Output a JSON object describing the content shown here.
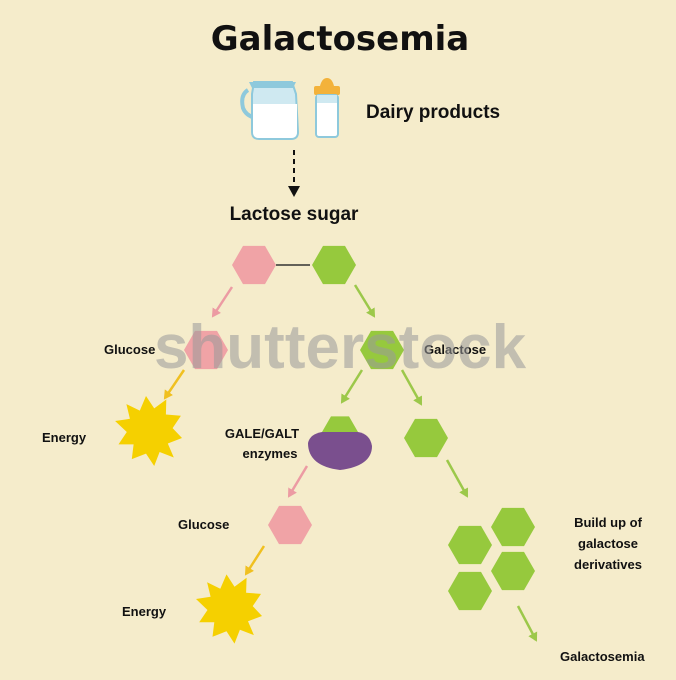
{
  "title": "Galactosemia",
  "dairy_label": "Dairy products",
  "lactose_label": "Lactose sugar",
  "glucose_1": "Glucose",
  "galactose_label": "Galactose",
  "energy_1": "Energy",
  "enzyme_line1": "GALE/GALT",
  "enzyme_line2": "enzymes",
  "glucose_2": "Glucose",
  "energy_2": "Energy",
  "buildup_line1": "Build up of",
  "buildup_line2": "galactose",
  "buildup_line3": "derivatives",
  "result_label": "Galactosemia",
  "watermark": "shutterstock",
  "colors": {
    "background": "#f5eccb",
    "glucose_pink": "#f0a3a6",
    "galactose_green": "#96c93d",
    "enzyme_purple": "#7a4f8e",
    "sun_yellow": "#f5d000",
    "arrow_pink": "#ec9ba3",
    "arrow_green": "#9cc84a",
    "arrow_yellow": "#f0c020"
  }
}
